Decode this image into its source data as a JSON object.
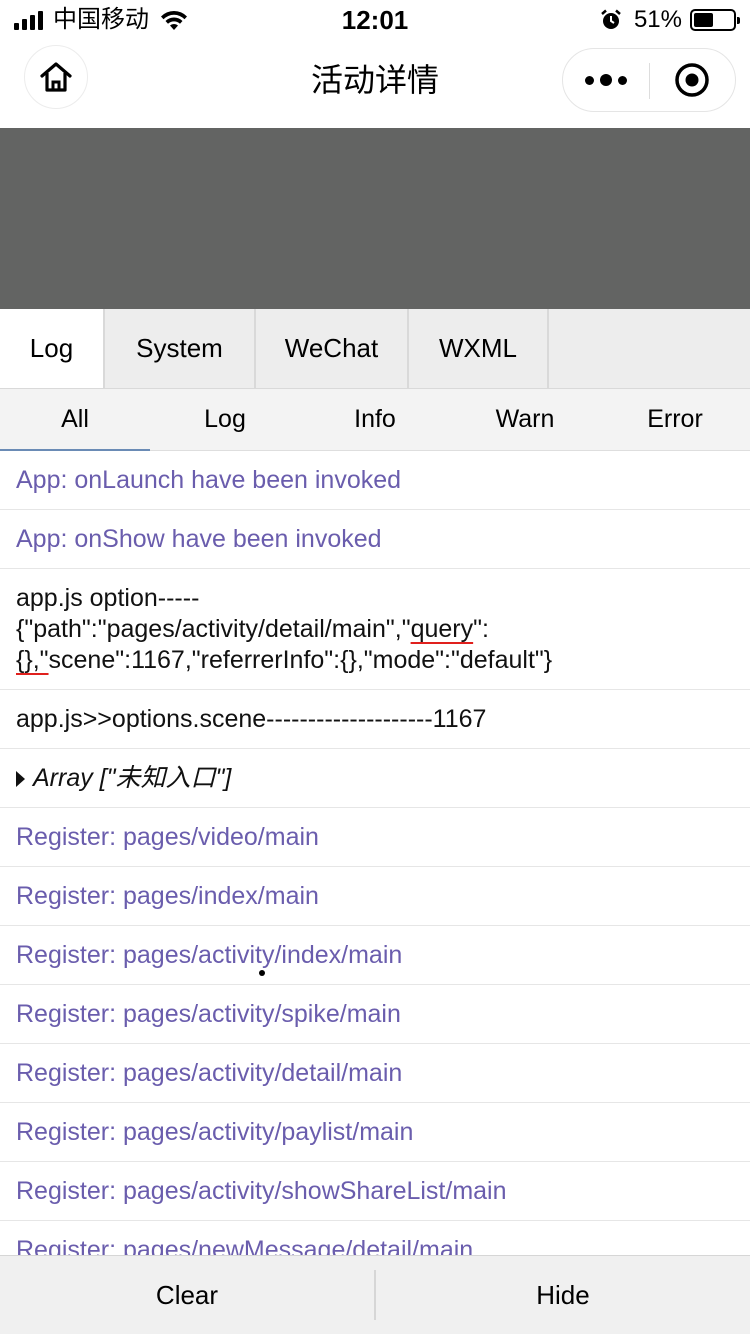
{
  "status_bar": {
    "carrier": "中国移动",
    "time": "12:01",
    "battery_pct": "51%",
    "battery_level": 0.51
  },
  "nav_bar": {
    "title": "活动详情",
    "home_icon": "home-icon",
    "more_icon": "more-dots-icon",
    "close_icon": "target-close-icon"
  },
  "vconsole": {
    "tabs": [
      {
        "label": "Log",
        "active": true
      },
      {
        "label": "System",
        "active": false
      },
      {
        "label": "WeChat",
        "active": false
      },
      {
        "label": "WXML",
        "active": false
      }
    ],
    "subtabs": [
      {
        "label": "All",
        "active": true
      },
      {
        "label": "Log",
        "active": false
      },
      {
        "label": "Info",
        "active": false
      },
      {
        "label": "Warn",
        "active": false
      },
      {
        "label": "Error",
        "active": false
      }
    ],
    "logs": {
      "item0": "App: onLaunch have been invoked",
      "item1": "App: onShow have been invoked",
      "item2": {
        "line1": "app.js option-----",
        "p1": "{\"path\":\"pages/activity/detail/main\",\"",
        "query": "query",
        "p2": "\":",
        "p3": "{},\"",
        "p4": "scene\":1167,\"referrerInfo\":{},\"mode\":\"default\"}"
      },
      "item3": "app.js>>options.scene--------------------1167",
      "item4": "Array [\"未知入口\"]",
      "register": [
        "Register: pages/video/main",
        "Register: pages/index/main",
        "Register: pages/activity/index/main",
        "Register: pages/activity/spike/main",
        "Register: pages/activity/detail/main",
        "Register: pages/activity/paylist/main",
        "Register: pages/activity/showShareList/main",
        "Register: pages/newMessage/detail/main"
      ]
    },
    "toolbar": {
      "clear": "Clear",
      "hide": "Hide"
    }
  },
  "colors": {
    "info_text": "#6a5dad",
    "banner": "#636463",
    "underline": "#e0201d"
  }
}
